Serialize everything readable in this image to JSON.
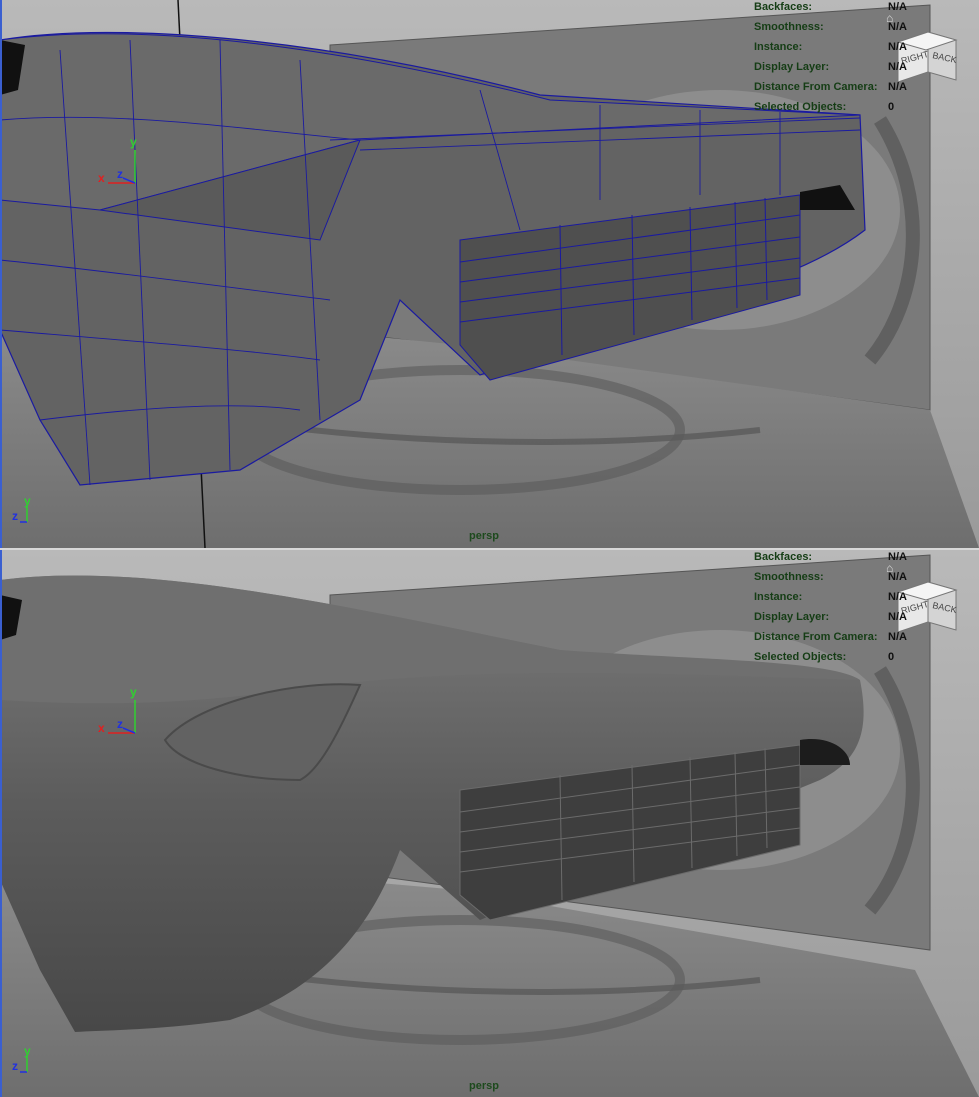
{
  "viewports": {
    "top": {
      "camera": "persp",
      "hud": [
        {
          "label": "Backfaces:",
          "value": "N/A"
        },
        {
          "label": "Smoothness:",
          "value": "N/A"
        },
        {
          "label": "Instance:",
          "value": "N/A"
        },
        {
          "label": "Display Layer:",
          "value": "N/A"
        },
        {
          "label": "Distance From Camera:",
          "value": "N/A"
        },
        {
          "label": "Selected Objects:",
          "value": "0"
        }
      ],
      "viewcube": {
        "right": "RIGHT",
        "back": "BACK"
      },
      "axes": {
        "x": "x",
        "y": "y",
        "z": "z"
      }
    },
    "bottom": {
      "camera": "persp",
      "hud": [
        {
          "label": "Backfaces:",
          "value": "N/A"
        },
        {
          "label": "Smoothness:",
          "value": "N/A"
        },
        {
          "label": "Instance:",
          "value": "N/A"
        },
        {
          "label": "Display Layer:",
          "value": "N/A"
        },
        {
          "label": "Distance From Camera:",
          "value": "N/A"
        },
        {
          "label": "Selected Objects:",
          "value": "0"
        }
      ],
      "viewcube": {
        "right": "RIGHT",
        "back": "BACK"
      },
      "axes": {
        "x": "x",
        "y": "y",
        "z": "z"
      }
    }
  },
  "colors": {
    "wireframe": "#1a1aa0",
    "mesh": "#5e5e5e",
    "hud_label": "#153d15",
    "axis_x": "#e02020",
    "axis_y": "#30d030",
    "axis_z": "#2030e0"
  }
}
